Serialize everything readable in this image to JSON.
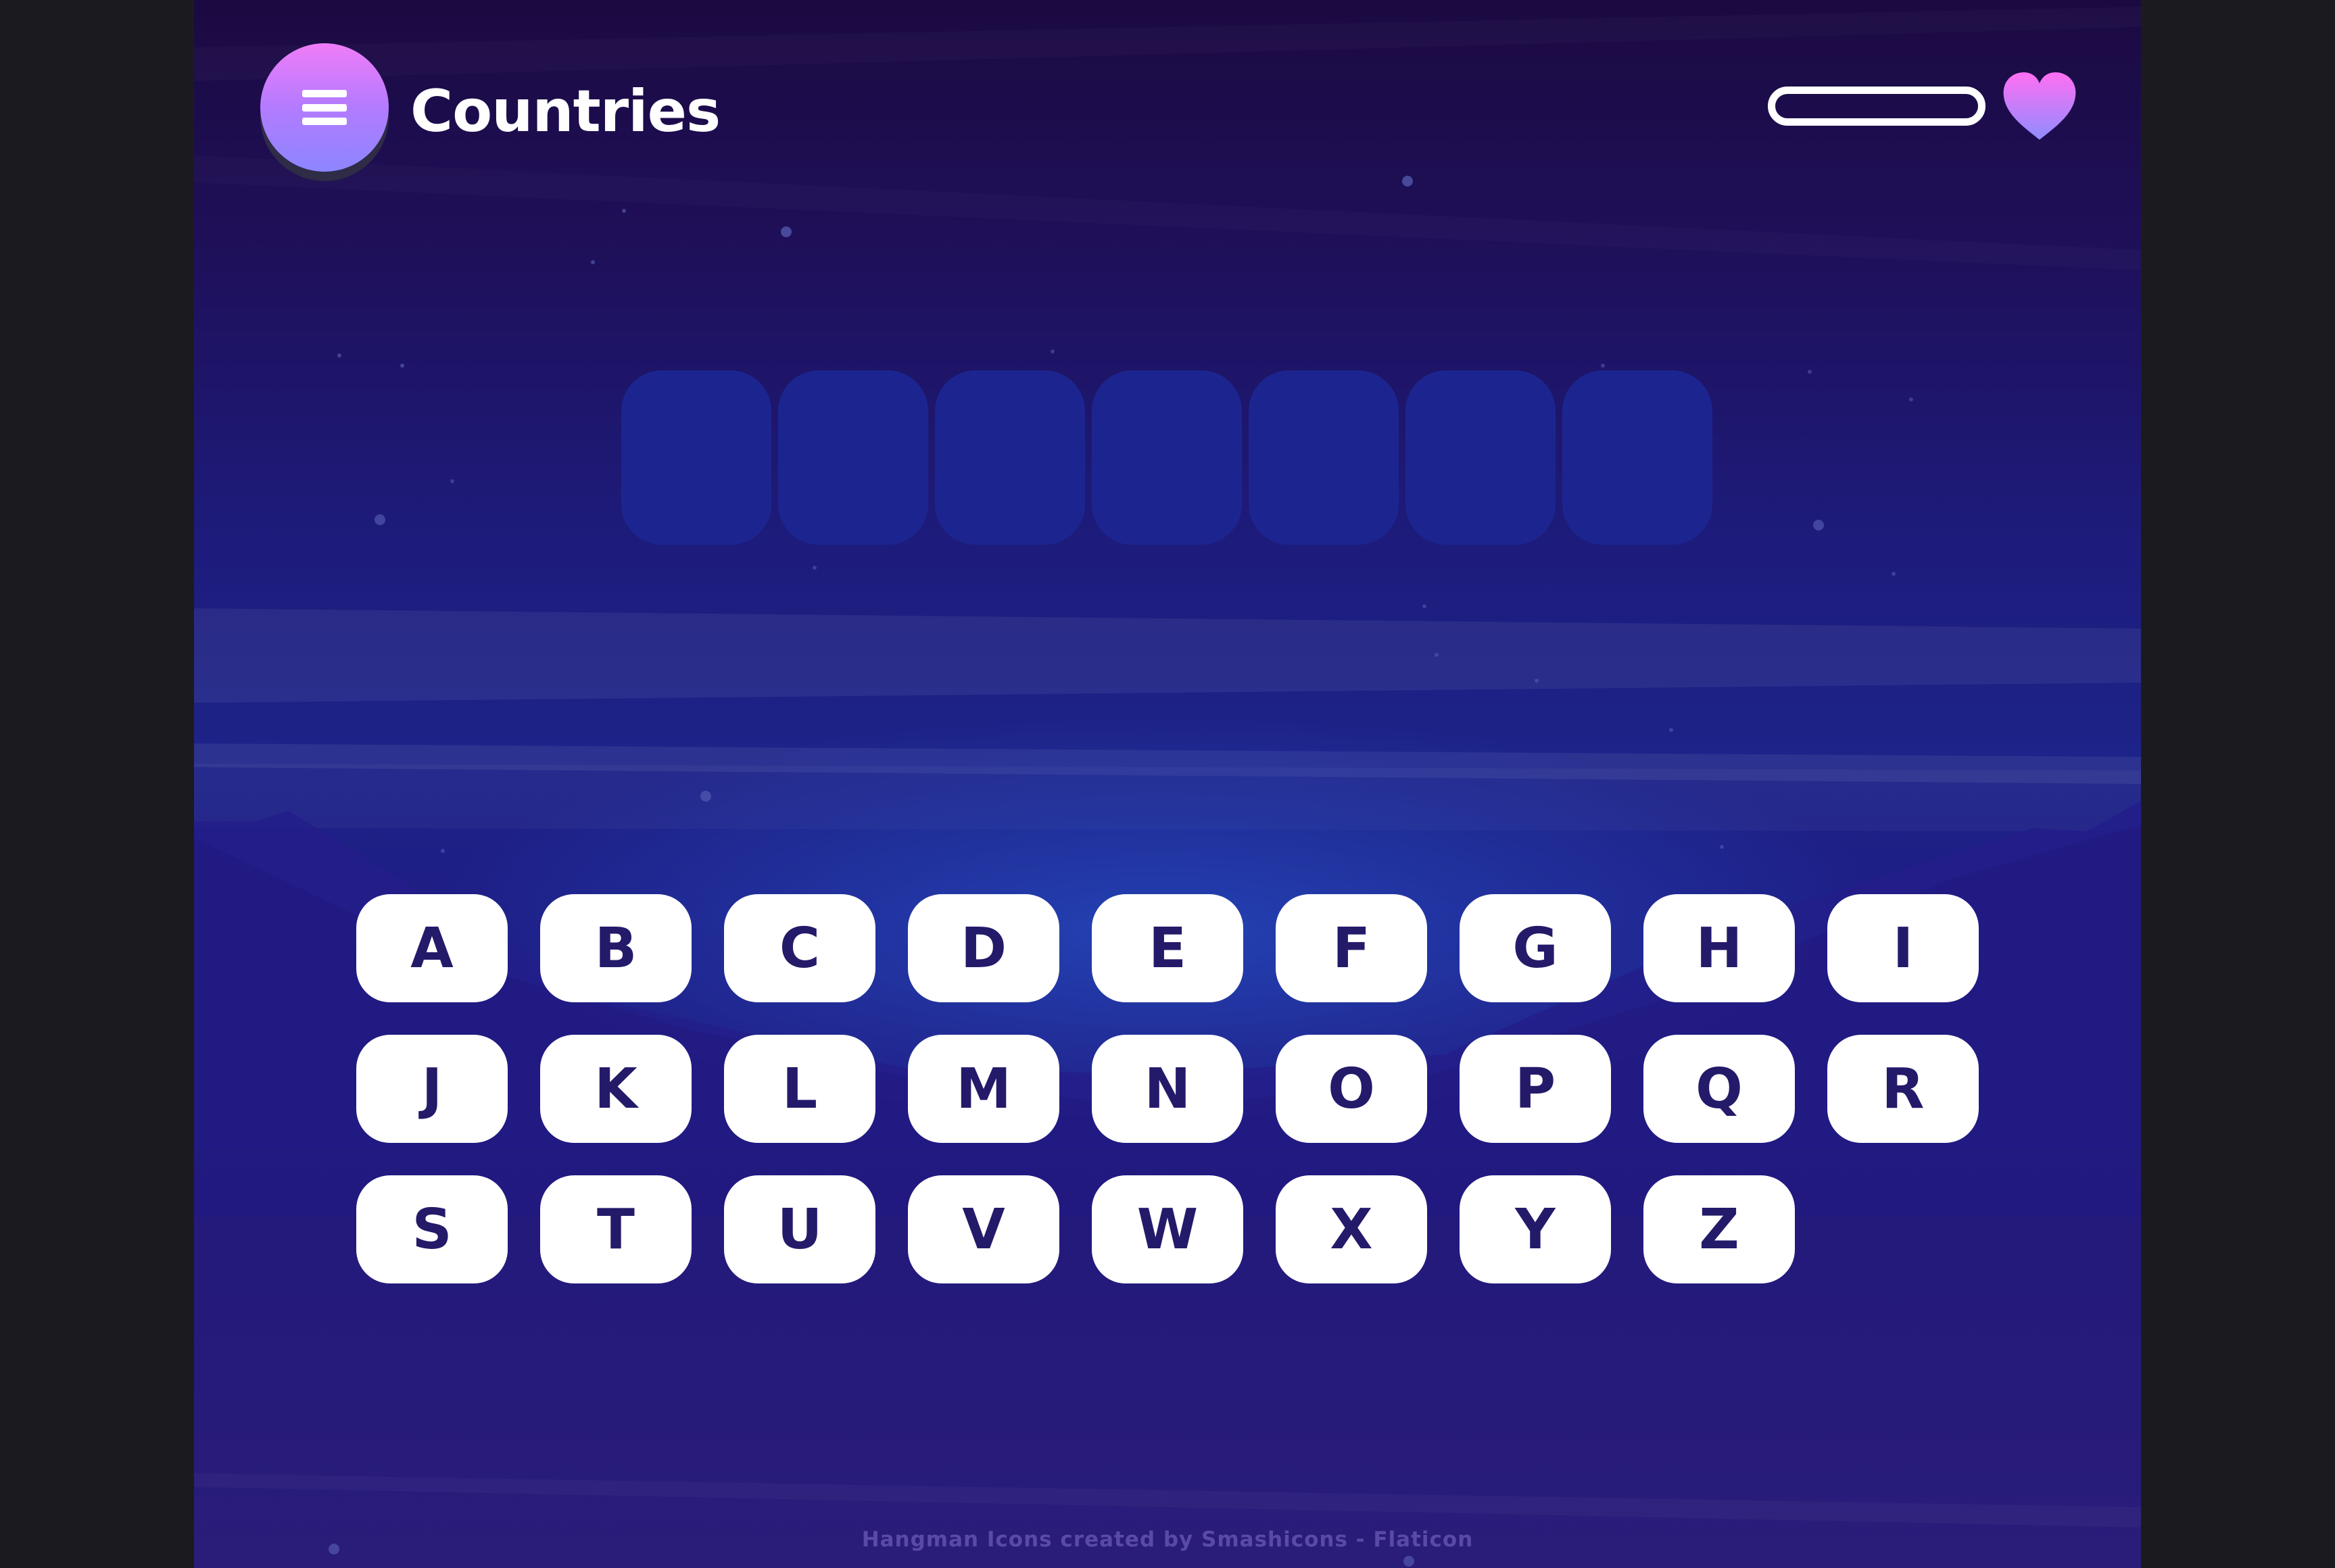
{
  "header": {
    "menu_icon": "hamburger-menu-icon",
    "category_title": "Countries",
    "health_level": 0,
    "life_icon": "heart-icon"
  },
  "word": {
    "slots": [
      "",
      "",
      "",
      "",
      "",
      "",
      ""
    ]
  },
  "keyboard": {
    "keys": [
      "A",
      "B",
      "C",
      "D",
      "E",
      "F",
      "G",
      "H",
      "I",
      "J",
      "K",
      "L",
      "M",
      "N",
      "O",
      "P",
      "Q",
      "R",
      "S",
      "T",
      "U",
      "V",
      "W",
      "X",
      "Y",
      "Z"
    ]
  },
  "footer": {
    "credit": "Hangman Icons created by Smashicons - Flaticon"
  },
  "colors": {
    "key_text": "#241a6a",
    "slot_fill": "#1c258f",
    "menu_gradient_top": "#f07cf8",
    "menu_gradient_bottom": "#8c86ff",
    "heart_top": "#ff6ff3",
    "heart_bottom": "#8f8cff"
  }
}
